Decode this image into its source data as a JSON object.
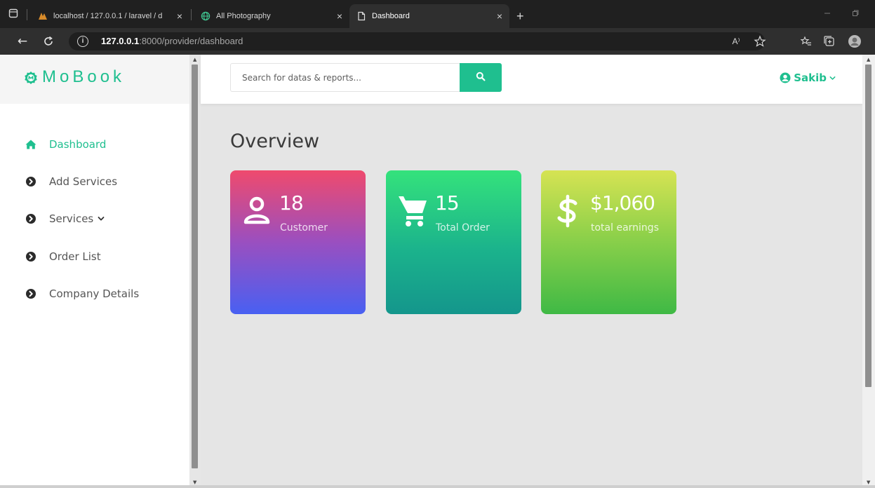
{
  "browser": {
    "tabs": [
      {
        "label": "localhost / 127.0.0.1 / laravel / d",
        "active": false
      },
      {
        "label": "All Photography",
        "active": false
      },
      {
        "label": "Dashboard",
        "active": true
      }
    ],
    "url_host": "127.0.0.1",
    "url_rest": ":8000/provider/dashboard",
    "url_info_glyph": "i",
    "read_aloud_glyph": "A⁾",
    "new_tab_glyph": "+",
    "tab_close_glyph": "×"
  },
  "sidebar": {
    "brand": "MoBook",
    "items": [
      {
        "label": "Dashboard",
        "icon": "home-icon",
        "active": true
      },
      {
        "label": "Add Services",
        "icon": "chevron-circle-right-icon",
        "active": false
      },
      {
        "label": "Services",
        "icon": "chevron-circle-right-icon",
        "active": false,
        "has_caret": true
      },
      {
        "label": "Order List",
        "icon": "chevron-circle-right-icon",
        "active": false
      },
      {
        "label": "Company Details",
        "icon": "chevron-circle-right-icon",
        "active": false
      }
    ]
  },
  "header": {
    "search_placeholder": "Search for datas & reports...",
    "user_name": "Sakib"
  },
  "main": {
    "title": "Overview",
    "cards": [
      {
        "value": "18",
        "label": "Customer",
        "icon": "user-icon"
      },
      {
        "value": "15",
        "label": "Total Order",
        "icon": "cart-icon"
      },
      {
        "value": "$1,060",
        "label": "total earnings",
        "icon": "dollar-icon"
      }
    ]
  },
  "colors": {
    "accent": "#1fbf8f",
    "page_background": "#e5e5e5"
  }
}
